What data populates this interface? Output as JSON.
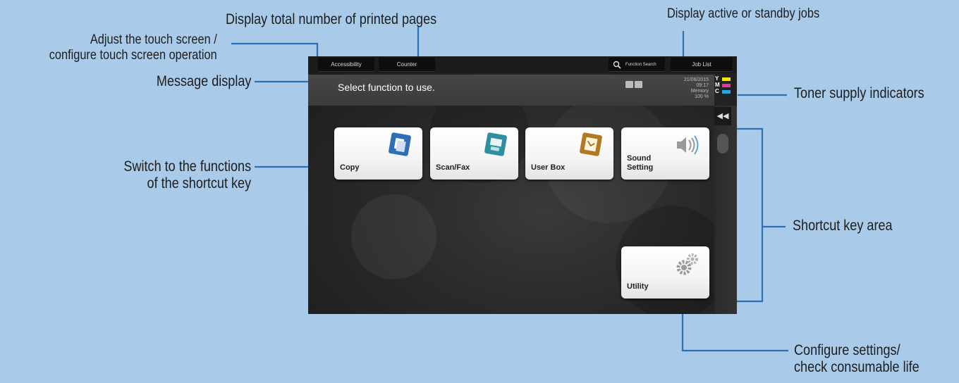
{
  "callouts": {
    "total_pages": "Display total number of printed pages",
    "active_jobs": "Display active or standby jobs",
    "adjust_line1": "Adjust the touch screen /",
    "adjust_line2": "configure touch screen operation",
    "message_display": "Message display",
    "toner": "Toner supply indicators",
    "switch_line1": "Switch to the functions",
    "switch_line2": "of the shortcut key",
    "shortcut_area": "Shortcut key area",
    "configure_line1": "Configure settings/",
    "configure_line2": "check consumable life"
  },
  "screen": {
    "topbar": {
      "accessibility": "Accessibility",
      "counter": "Counter",
      "function_search": "Function Search",
      "job_list": "Job List"
    },
    "message": "Select function to use.",
    "datetime": {
      "date": "21/06/2015",
      "time": "09:17",
      "memory_label": "Memory",
      "memory_value": "100 %"
    },
    "toner": [
      {
        "letter": "Y",
        "color": "#f1e21b"
      },
      {
        "letter": "M",
        "color": "#e0379a"
      },
      {
        "letter": "C",
        "color": "#2aa8dc"
      }
    ],
    "collapse_icon": "◀◀",
    "tiles": {
      "copy": "Copy",
      "scan_fax": "Scan/Fax",
      "user_box": "User Box",
      "sound_setting_1": "Sound",
      "sound_setting_2": "Setting",
      "utility": "Utility"
    }
  },
  "colors": {
    "background": "#a9cbe9",
    "callout_line": "#2d6fb3",
    "copy_icon": "#2f6fb5",
    "scan_icon": "#2f8fa0",
    "userbox_icon": "#b07a22"
  }
}
